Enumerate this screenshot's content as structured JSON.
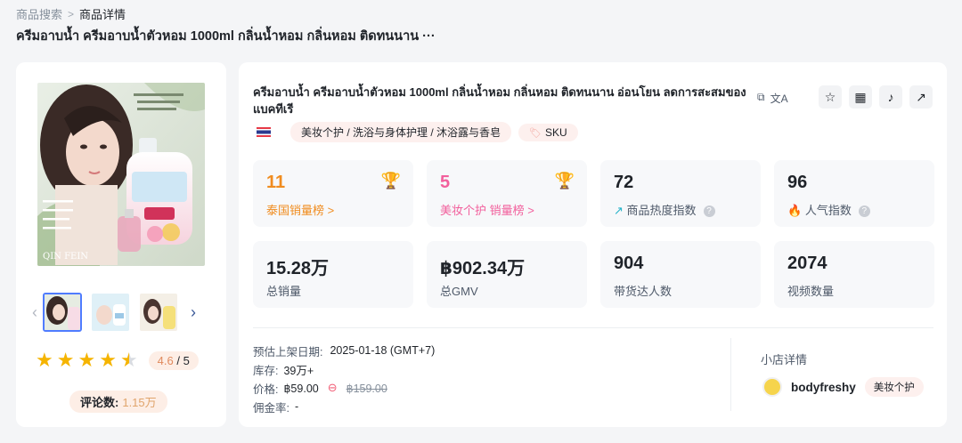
{
  "breadcrumb": {
    "parent": "商品搜索",
    "separator": ">",
    "current": "商品详情"
  },
  "page_title": "ครีมอาบน้ำ ครีมอาบน้ำตัวหอม 1000ml กลิ่นน้ำหอม กลิ่นหอม ติดทนนาน ···",
  "product": {
    "title": "ครีมอาบน้ำ ครีมอาบน้ำตัวหอม 1000ml กลิ่นน้ำหอม กลิ่นหอม ติดทนนาน อ่อนโยน ลดการสะสมของแบคทีเรี",
    "brand_watermark": "QIN FEIN",
    "category_tag": "美妆个护 / 洗浴与身体护理 / 沐浴露与香皂",
    "sku_tag": "SKU",
    "rating": "4.6",
    "rating_max": "/ 5",
    "rating_value": 4.6,
    "reviews_label": "评论数:",
    "reviews_value": "1.15万"
  },
  "stats": {
    "rank_country": {
      "value": "11",
      "label": "泰国销量榜 >",
      "color": "#f08c1f"
    },
    "rank_category": {
      "value": "5",
      "label": "美妆个护 销量榜 >",
      "color": "#f25f9c"
    },
    "heat": {
      "value": "72",
      "label": "商品热度指数",
      "icon": "trend-icon"
    },
    "popularity": {
      "value": "96",
      "label": "人气指数",
      "icon": "fire-icon"
    },
    "sales": {
      "value": "15.28万",
      "label": "总销量"
    },
    "gmv": {
      "value": "฿902.34万",
      "label": "总GMV"
    },
    "creators": {
      "value": "904",
      "label": "带货达人数"
    },
    "videos": {
      "value": "2074",
      "label": "视频数量"
    }
  },
  "info": {
    "launch_label": "预估上架日期:",
    "launch_value": "2025-01-18 (GMT+7)",
    "stock_label": "库存:",
    "stock_value": "39万+",
    "price_label": "价格:",
    "price_value": "฿59.00",
    "price_original": "฿159.00",
    "commission_label": "佣金率:",
    "commission_value": "-"
  },
  "shop": {
    "title": "小店详情",
    "name": "bodyfreshy",
    "category": "美妆个护"
  }
}
